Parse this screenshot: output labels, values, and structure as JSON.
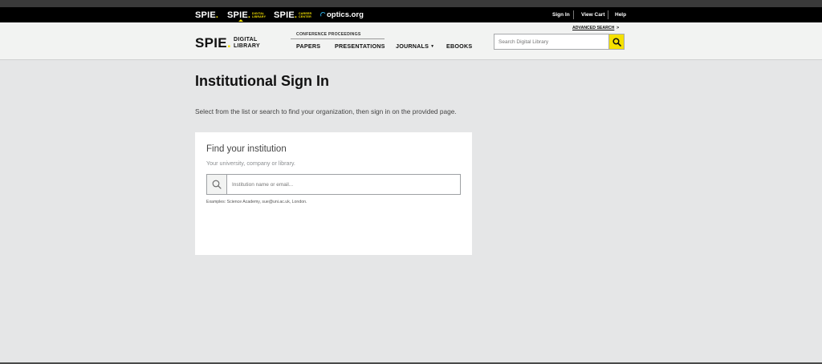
{
  "topbar": {
    "brands": [
      {
        "mark": "SPIE",
        "sub_line1": "",
        "sub_line2": ""
      },
      {
        "mark": "SPIE",
        "sub_line1": "DIGITAL",
        "sub_line2": "LIBRARY"
      },
      {
        "mark": "SPIE",
        "sub_line1": "CAREER",
        "sub_line2": "CENTER"
      }
    ],
    "optics_label": "optics.org",
    "links": {
      "sign_in": "Sign In",
      "view_cart": "View Cart",
      "help": "Help"
    }
  },
  "header": {
    "logo": {
      "word": "SPIE",
      "tag_line1": "DIGITAL",
      "tag_line2": "LIBRARY"
    },
    "conference_label": "CONFERENCE PROCEEDINGS",
    "nav": {
      "papers": "PAPERS",
      "presentations": "PRESENTATIONS",
      "journals": "JOURNALS",
      "ebooks": "EBOOKS"
    },
    "advanced_search": "ADVANCED SEARCH",
    "advanced_search_arrow": ">",
    "search_placeholder": "Search Digital Library"
  },
  "main": {
    "title": "Institutional Sign In",
    "intro": "Select from the list or search to find your organization, then sign in on the provided page.",
    "card": {
      "title": "Find your institution",
      "subtitle": "Your university, company or library.",
      "input_placeholder": "Institution name or email...",
      "examples": "Examples: Science Academy, sue@uni.ac.uk, London."
    }
  },
  "colors": {
    "accent": "#f5e100",
    "topbar": "#000000",
    "page_bg": "#e5e6e7",
    "optics_blue": "#2aa9e0"
  }
}
